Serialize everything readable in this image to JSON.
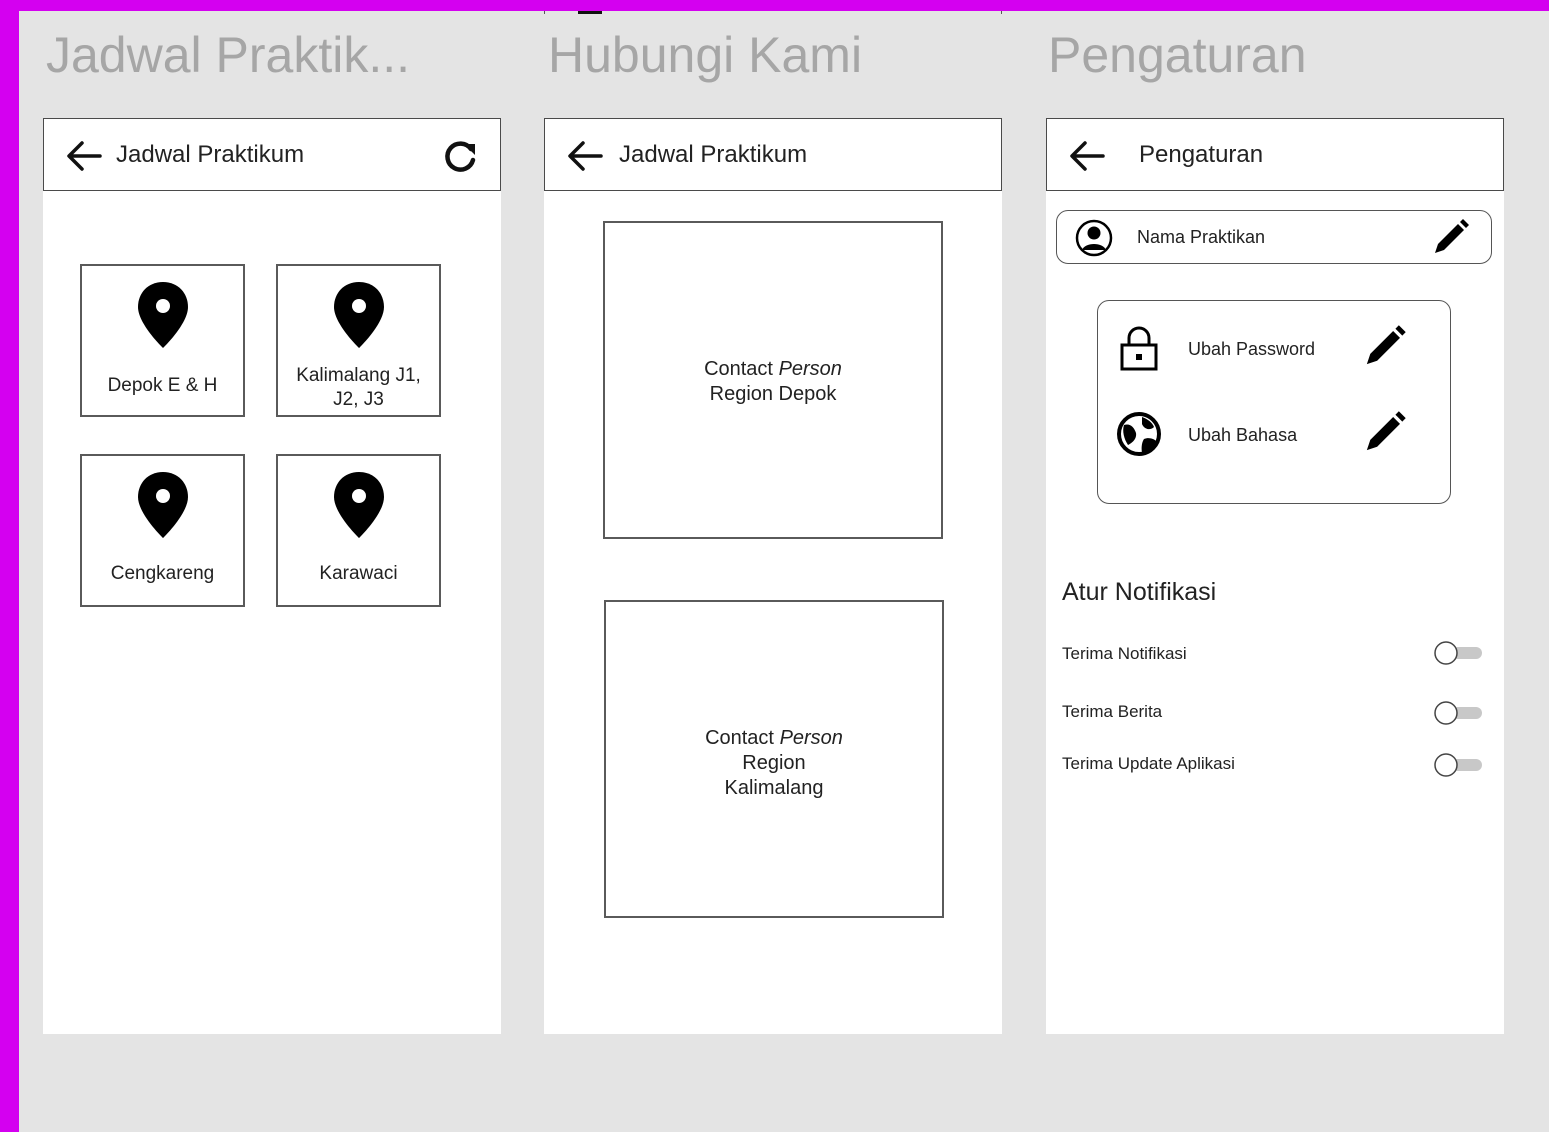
{
  "frames": [
    {
      "title": "Jadwal Praktik...",
      "header": {
        "title": "Jadwal Praktikum"
      },
      "locations": [
        {
          "label": "Depok E & H"
        },
        {
          "label": "Kalimalang J1, J2, J3"
        },
        {
          "label": "Cengkareng"
        },
        {
          "label": "Karawaci"
        }
      ]
    },
    {
      "title": "Hubungi Kami",
      "header": {
        "title": "Jadwal Praktikum"
      },
      "contacts": [
        {
          "line1": "Contact",
          "line1_italic": "Person",
          "line2": "Region Depok",
          "line3": ""
        },
        {
          "line1": "Contact",
          "line1_italic": "Person",
          "line2": "Region",
          "line3": "Kalimalang"
        }
      ]
    },
    {
      "title": "Pengaturan",
      "header": {
        "title": "Pengaturan"
      },
      "profile": {
        "name": "Nama Praktikan"
      },
      "options": [
        {
          "label": "Ubah Password",
          "icon": "lock-icon"
        },
        {
          "label": "Ubah Bahasa",
          "icon": "globe-icon"
        }
      ],
      "notifications": {
        "heading": "Atur Notifikasi",
        "items": [
          {
            "label": "Terima Notifikasi",
            "enabled": false
          },
          {
            "label": "Terima Berita",
            "enabled": false
          },
          {
            "label": "Terima Update Aplikasi",
            "enabled": false
          }
        ]
      }
    }
  ],
  "colors": {
    "background": "#e4e4e4",
    "accent_border": "#d400f0",
    "title_gray": "#a6a6a6"
  }
}
